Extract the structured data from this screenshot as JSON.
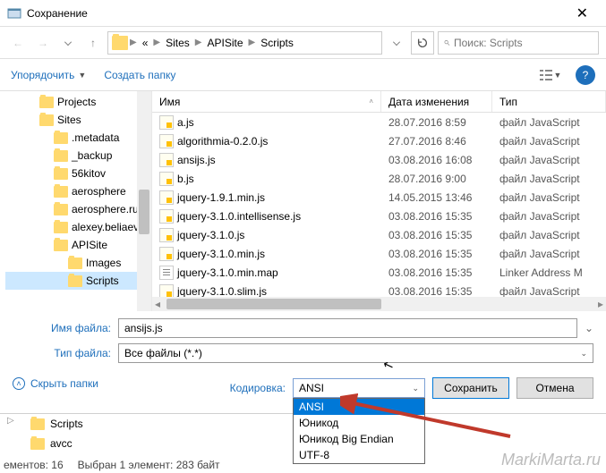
{
  "window": {
    "title": "Сохранение"
  },
  "nav": {
    "crumbs": [
      "Sites",
      "APISite",
      "Scripts"
    ],
    "search_placeholder": "Поиск: Scripts"
  },
  "toolbar": {
    "organize": "Упорядочить",
    "new_folder": "Создать папку"
  },
  "tree": [
    {
      "label": "Projects",
      "depth": 1
    },
    {
      "label": "Sites",
      "depth": 1
    },
    {
      "label": ".metadata",
      "depth": 2
    },
    {
      "label": "_backup",
      "depth": 2
    },
    {
      "label": "56kitov",
      "depth": 2
    },
    {
      "label": "aerosphere",
      "depth": 2
    },
    {
      "label": "aerosphere.ru",
      "depth": 2
    },
    {
      "label": "alexey.beliaev",
      "depth": 2
    },
    {
      "label": "APISite",
      "depth": 2
    },
    {
      "label": "Images",
      "depth": 3
    },
    {
      "label": "Scripts",
      "depth": 3,
      "selected": true
    }
  ],
  "columns": {
    "name": "Имя",
    "date": "Дата изменения",
    "type": "Тип"
  },
  "files": [
    {
      "name": "a.js",
      "date": "28.07.2016 8:59",
      "type": "файл JavaScript",
      "icon": "js"
    },
    {
      "name": "algorithmia-0.2.0.js",
      "date": "27.07.2016 8:46",
      "type": "файл JavaScript",
      "icon": "js"
    },
    {
      "name": "ansijs.js",
      "date": "03.08.2016 16:08",
      "type": "файл JavaScript",
      "icon": "js"
    },
    {
      "name": "b.js",
      "date": "28.07.2016 9:00",
      "type": "файл JavaScript",
      "icon": "js"
    },
    {
      "name": "jquery-1.9.1.min.js",
      "date": "14.05.2015 13:46",
      "type": "файл JavaScript",
      "icon": "js"
    },
    {
      "name": "jquery-3.1.0.intellisense.js",
      "date": "03.08.2016 15:35",
      "type": "файл JavaScript",
      "icon": "js"
    },
    {
      "name": "jquery-3.1.0.js",
      "date": "03.08.2016 15:35",
      "type": "файл JavaScript",
      "icon": "js"
    },
    {
      "name": "jquery-3.1.0.min.js",
      "date": "03.08.2016 15:35",
      "type": "файл JavaScript",
      "icon": "js"
    },
    {
      "name": "jquery-3.1.0.min.map",
      "date": "03.08.2016 15:35",
      "type": "Linker Address M",
      "icon": "map"
    },
    {
      "name": "jquery-3.1.0.slim.js",
      "date": "03.08.2016 15:35",
      "type": "файл JavaScript",
      "icon": "js"
    }
  ],
  "form": {
    "filename_label": "Имя файла:",
    "filename_value": "ansijs.js",
    "filetype_label": "Тип файла:",
    "filetype_value": "Все файлы  (*.*)"
  },
  "bottom": {
    "hide_folders": "Скрыть папки",
    "encoding_label": "Кодировка:",
    "encoding_value": "ANSI",
    "encoding_options": [
      "ANSI",
      "Юникод",
      "Юникод Big Endian",
      "UTF-8"
    ],
    "save": "Сохранить",
    "cancel": "Отмена"
  },
  "below": {
    "items": [
      "Scripts",
      "avcc"
    ],
    "status_count": "ементов: 16",
    "status_sel": "Выбран 1 элемент: 283 байт"
  },
  "watermark": "MarkiMarta.ru"
}
